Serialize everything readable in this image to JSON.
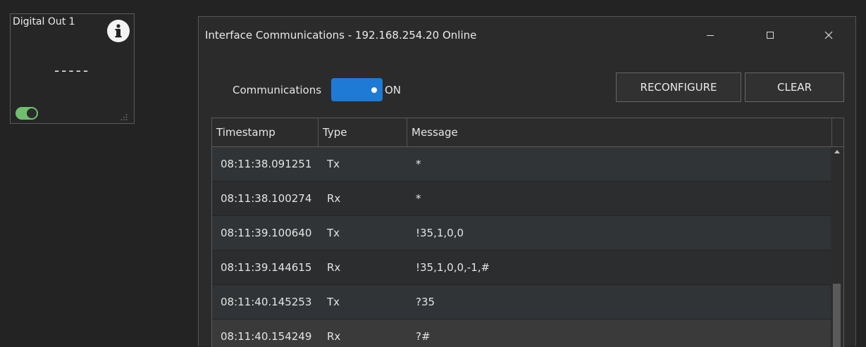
{
  "widget": {
    "title": "Digital Out 1",
    "value": "-----",
    "info_icon": "info-icon",
    "toggle_on": true
  },
  "dialog": {
    "title": "Interface Communications - 192.168.254.20 Online",
    "communications_label": "Communications",
    "toggle_state": "ON",
    "reconfigure_label": "RECONFIGURE",
    "clear_label": "CLEAR",
    "columns": [
      "Timestamp",
      "Type",
      "Message"
    ],
    "rows": [
      {
        "timestamp": "08:11:38.091251",
        "type": "Tx",
        "message": "*"
      },
      {
        "timestamp": "08:11:38.100274",
        "type": "Rx",
        "message": "*"
      },
      {
        "timestamp": "08:11:39.100640",
        "type": "Tx",
        "message": "!35,1,0,0"
      },
      {
        "timestamp": "08:11:39.144615",
        "type": "Rx",
        "message": "!35,1,0,0,-1,#"
      },
      {
        "timestamp": "08:11:40.145253",
        "type": "Tx",
        "message": "?35"
      },
      {
        "timestamp": "08:11:40.154249",
        "type": "Rx",
        "message": "?#"
      }
    ]
  },
  "colors": {
    "background": "#232323",
    "accent": "#1f7ad6",
    "toggle_green": "#6fbf6f"
  }
}
